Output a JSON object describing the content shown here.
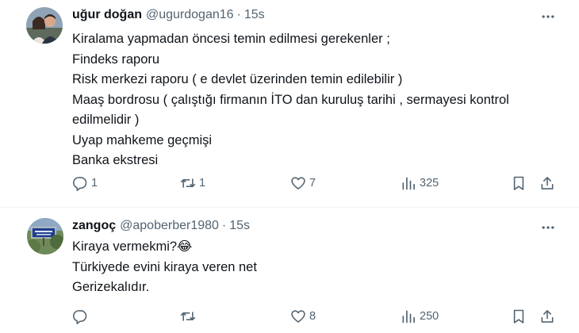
{
  "tweets": [
    {
      "name": "uğur doğan",
      "handle": "@ugurdogan16",
      "separator": "·",
      "time": "15s",
      "lines": [
        "Kiralama yapmadan öncesi temin edilmesi gerekenler ;",
        "Findeks raporu",
        "Risk merkezi raporu  ( e devlet üzerinden temin edilebilir )",
        "Maaş bordrosu ( çalıştığı firmanın İTO dan kuruluş tarihi , sermayesi kontrol",
        "edilmelidir )",
        "Uyap mahkeme geçmişi",
        "Banka ekstresi"
      ],
      "stats": {
        "replies": "1",
        "retweets": "1",
        "likes": "7",
        "views": "325"
      }
    },
    {
      "name": "zangoç",
      "handle": "@apoberber1980",
      "separator": "·",
      "time": "15s",
      "lines": [
        "Kiraya vermekmi?😂",
        "Türkiyede evini kiraya veren net",
        "Gerizekalıdır."
      ],
      "stats": {
        "replies": "",
        "retweets": "",
        "likes": "8",
        "views": "250"
      }
    }
  ],
  "icons": [
    "more-icon",
    "reply-icon",
    "retweet-icon",
    "like-icon",
    "views-icon",
    "bookmark-icon",
    "share-icon"
  ],
  "colors": {
    "text": "#0f1419",
    "secondary": "#536471",
    "divider": "#eff3f4"
  }
}
